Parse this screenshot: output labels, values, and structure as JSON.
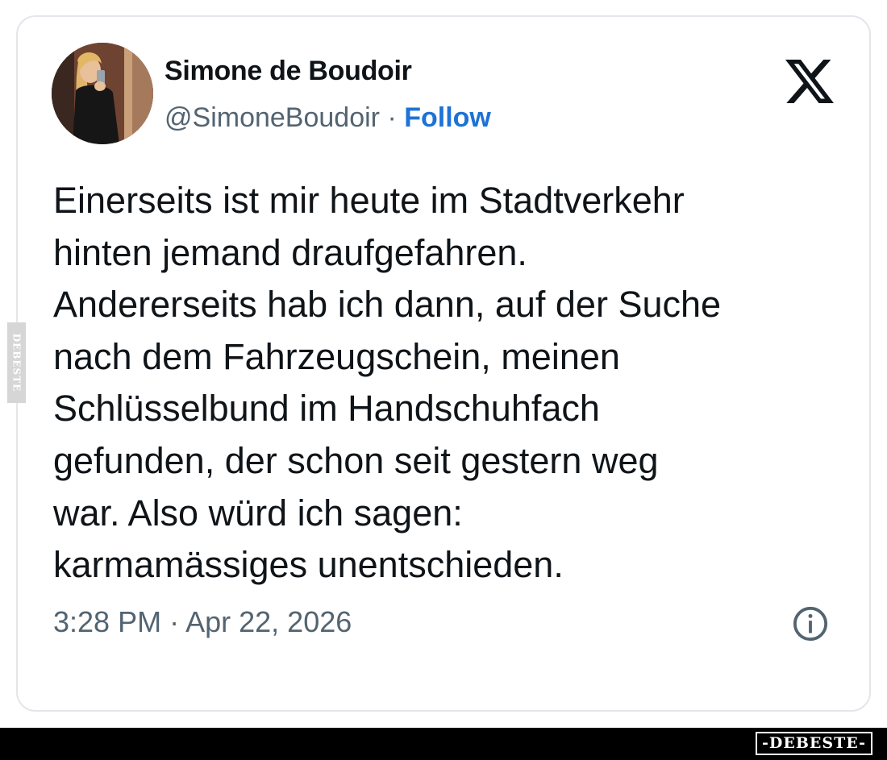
{
  "tweet": {
    "display_name": "Simone de Boudoir",
    "handle": "@SimoneBoudoir",
    "separator": "·",
    "follow_label": "Follow",
    "text_lines": [
      "Einerseits ist mir heute im Stadtverkehr",
      "hinten jemand draufgefahren.",
      "Andererseits hab ich dann, auf der Suche",
      "nach dem Fahrzeugschein, meinen",
      "Schlüsselbund im Handschuhfach",
      "gefunden, der schon seit gestern weg",
      "war. Also würd ich sagen:",
      "karmamässiges unentschieden."
    ],
    "time": "3:28 PM",
    "date": "Apr 22, 2026"
  },
  "icons": {
    "platform_logo": "x-logo-icon",
    "info": "info-icon"
  },
  "watermark": {
    "side_text": "DEBESTE",
    "footer_text": "-DEBESTE-"
  },
  "colors": {
    "text": "#0f1419",
    "secondary": "#536471",
    "follow": "#1d72d6",
    "border": "#e3e6ea"
  }
}
